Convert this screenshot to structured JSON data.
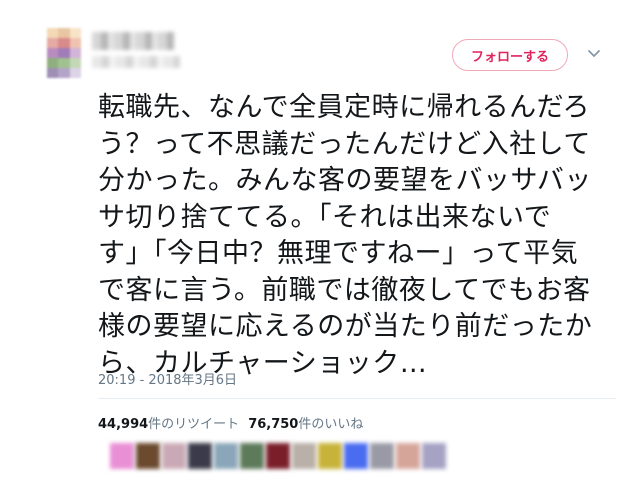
{
  "tweet": {
    "follow_label": "フォローする",
    "menu_icon": "chevron-down-icon",
    "text_lines": [
      "転職先、なんで全員定時に帰れるんだろ",
      "う？って不思議だったんだけど入社して",
      "分かった。みんな客の要望をバッサバッ",
      "サ切り捨ててる。「それは出来ないで",
      "す」「今日中？無理ですねー」って平気",
      "で客に言う。前職では徹夜してでもお客",
      "様の要望に応えるのが当たり前だったか",
      "ら、カルチャーショック…"
    ],
    "timestamp": "20:19 - 2018年3月6日",
    "retweet_count": "44,994",
    "retweet_label": "件のリツイート",
    "like_count": "76,750",
    "like_label": "件のいいね"
  },
  "colors": {
    "accent": "#e0245e",
    "follow_border": "#f0a9b8",
    "meta_text": "#657786",
    "body_text": "#14171a"
  }
}
